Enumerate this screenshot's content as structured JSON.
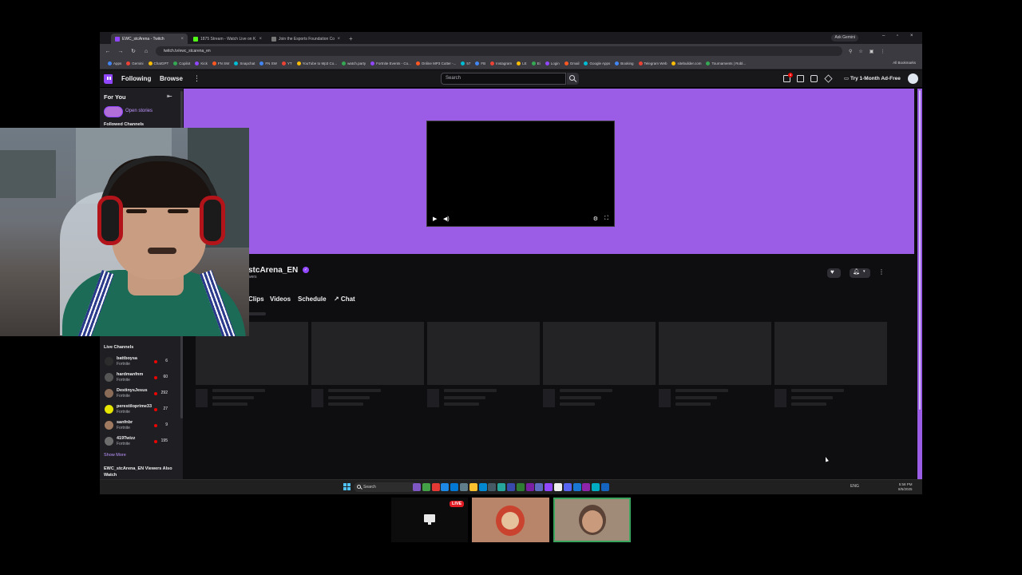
{
  "browser": {
    "tabs": [
      {
        "label": "EWC_stcArena - Twitch",
        "color": "#9147ff",
        "active": true
      },
      {
        "label": "1875 Stream - Watch Live on K",
        "color": "#53fc18",
        "active": false
      },
      {
        "label": "Join the Esports Foundation Co",
        "color": "#888888",
        "active": false
      }
    ],
    "new_tab": "+",
    "profile": "Ask Gemini",
    "url": "twitch.tv/ewc_stcarena_en",
    "bookmarks": [
      "Apps",
      "Gemini",
      "ChatGPT",
      "Copilot",
      "Kick",
      "FN SW",
      "Snapchat",
      "FN SW",
      "YT",
      "YouTube to Mp3 Co...",
      "watch.party",
      "Fortnite Events - Co...",
      "Online MP3 Cutter -...",
      "57",
      "FB",
      "Instagram",
      "LE",
      "Ei",
      "Login",
      "Gmail",
      "Google Apps",
      "Booking",
      "Telegram Web",
      "sitebuilder.com",
      "Tournaments | Robl..."
    ],
    "all_bookmarks": "All Bookmarks"
  },
  "twitch": {
    "nav": {
      "following": "Following",
      "browse": "Browse",
      "more": "⋮",
      "search_placeholder": "Search",
      "notif_count": "4",
      "ad_free": "Try 1-Month Ad-Free"
    },
    "sidebar": {
      "title": "For You",
      "collapse": "⇤",
      "stories": "Open stories",
      "followed_header": "Followed Channels",
      "live_header": "Live Channels",
      "channels": [
        {
          "name": "battboysa",
          "game": "Fortnite",
          "viewers": "6",
          "color": "#2c2c2c"
        },
        {
          "name": "hardmanfnm",
          "game": "Fortnite",
          "viewers": "60",
          "color": "#555555"
        },
        {
          "name": "DestinysJesus",
          "game": "Fortnite",
          "viewers": "292",
          "color": "#8a6b58"
        },
        {
          "name": "perestiloprime33",
          "game": "Fortnite",
          "viewers": "27",
          "color": "#e6e600"
        },
        {
          "name": "sanfnbr",
          "game": "Fortnite",
          "viewers": "9",
          "color": "#a07a60"
        },
        {
          "name": "419Twizz",
          "game": "Fortnite",
          "viewers": "195",
          "color": "#6d6d6d"
        }
      ],
      "show_more": "Show More",
      "also_watch": "EWC_stcArena_EN Viewers Also Watch"
    },
    "channel": {
      "name": "stcArena_EN",
      "verified": "✓",
      "viewers": "wers",
      "tabs": [
        "Clips",
        "Videos",
        "Schedule",
        "↗ Chat"
      ]
    }
  },
  "taskbar": {
    "search": "Search",
    "tray": "ENG",
    "time": "5:58 PM",
    "date": "8/5/2025"
  },
  "call": {
    "live_badge": "LIVE"
  },
  "colors": {
    "twitch_purple": "#9147ff",
    "offline_banner": "#9b5de5",
    "live_red": "#eb0400"
  }
}
